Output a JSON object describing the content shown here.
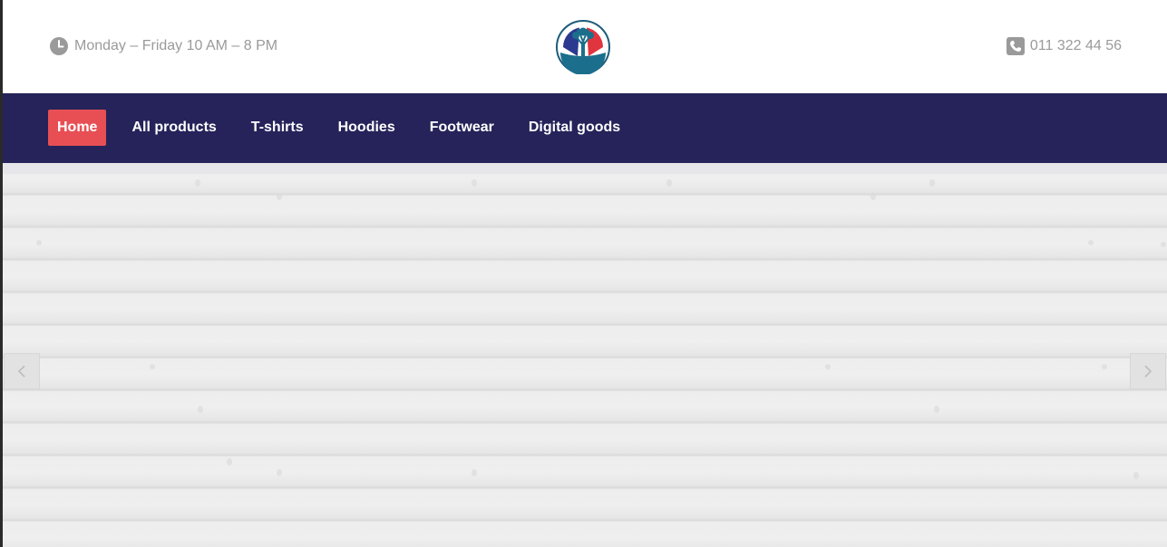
{
  "header": {
    "hours_text": "Monday – Friday 10 AM – 8 PM",
    "phone_text": "011 322 44 56",
    "icons": {
      "hours": "clock-icon",
      "phone": "phone-icon",
      "logo": "tree-logo"
    }
  },
  "nav": {
    "items": [
      {
        "label": "Home",
        "active": true
      },
      {
        "label": "All products",
        "active": false
      },
      {
        "label": "T-shirts",
        "active": false
      },
      {
        "label": "Hoodies",
        "active": false
      },
      {
        "label": "Footwear",
        "active": false
      },
      {
        "label": "Digital goods",
        "active": false
      }
    ]
  },
  "slider": {
    "prev_icon": "chevron-left-icon",
    "next_icon": "chevron-right-icon"
  },
  "colors": {
    "nav_background": "#252359",
    "active_item": "#e74f55",
    "muted_text": "#9a9a9a",
    "hero_background": "#ececec"
  }
}
